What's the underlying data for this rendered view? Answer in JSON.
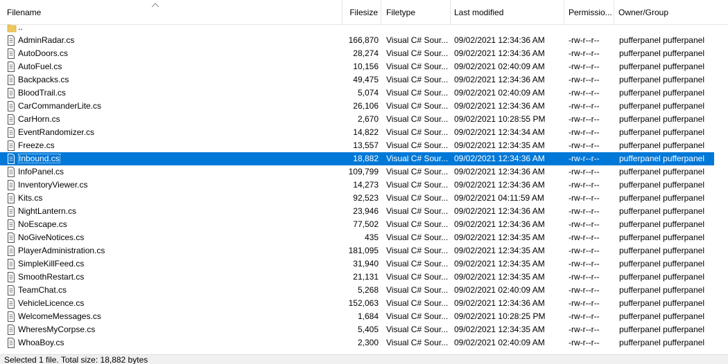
{
  "columns": {
    "filename": "Filename",
    "filesize": "Filesize",
    "filetype": "Filetype",
    "last_modified": "Last modified",
    "permissions": "Permissio...",
    "owner_group": "Owner/Group"
  },
  "parent_dir": "..",
  "files": [
    {
      "name": "AdminRadar.cs",
      "size": "166,870",
      "type": "Visual C# Sour...",
      "modified": "09/02/2021 12:34:36 AM",
      "perm": "-rw-r--r--",
      "owner": "pufferpanel pufferpanel"
    },
    {
      "name": "AutoDoors.cs",
      "size": "28,274",
      "type": "Visual C# Sour...",
      "modified": "09/02/2021 12:34:36 AM",
      "perm": "-rw-r--r--",
      "owner": "pufferpanel pufferpanel"
    },
    {
      "name": "AutoFuel.cs",
      "size": "10,156",
      "type": "Visual C# Sour...",
      "modified": "09/02/2021 02:40:09 AM",
      "perm": "-rw-r--r--",
      "owner": "pufferpanel pufferpanel"
    },
    {
      "name": "Backpacks.cs",
      "size": "49,475",
      "type": "Visual C# Sour...",
      "modified": "09/02/2021 12:34:36 AM",
      "perm": "-rw-r--r--",
      "owner": "pufferpanel pufferpanel"
    },
    {
      "name": "BloodTrail.cs",
      "size": "5,074",
      "type": "Visual C# Sour...",
      "modified": "09/02/2021 02:40:09 AM",
      "perm": "-rw-r--r--",
      "owner": "pufferpanel pufferpanel"
    },
    {
      "name": "CarCommanderLite.cs",
      "size": "26,106",
      "type": "Visual C# Sour...",
      "modified": "09/02/2021 12:34:36 AM",
      "perm": "-rw-r--r--",
      "owner": "pufferpanel pufferpanel"
    },
    {
      "name": "CarHorn.cs",
      "size": "2,670",
      "type": "Visual C# Sour...",
      "modified": "09/02/2021 10:28:55 PM",
      "perm": "-rw-r--r--",
      "owner": "pufferpanel pufferpanel"
    },
    {
      "name": "EventRandomizer.cs",
      "size": "14,822",
      "type": "Visual C# Sour...",
      "modified": "09/02/2021 12:34:34 AM",
      "perm": "-rw-r--r--",
      "owner": "pufferpanel pufferpanel"
    },
    {
      "name": "Freeze.cs",
      "size": "13,557",
      "type": "Visual C# Sour...",
      "modified": "09/02/2021 12:34:35 AM",
      "perm": "-rw-r--r--",
      "owner": "pufferpanel pufferpanel"
    },
    {
      "name": "Inbound.cs",
      "size": "18,882",
      "type": "Visual C# Sour...",
      "modified": "09/02/2021 12:34:36 AM",
      "perm": "-rw-r--r--",
      "owner": "pufferpanel pufferpanel",
      "selected": true
    },
    {
      "name": "InfoPanel.cs",
      "size": "109,799",
      "type": "Visual C# Sour...",
      "modified": "09/02/2021 12:34:36 AM",
      "perm": "-rw-r--r--",
      "owner": "pufferpanel pufferpanel"
    },
    {
      "name": "InventoryViewer.cs",
      "size": "14,273",
      "type": "Visual C# Sour...",
      "modified": "09/02/2021 12:34:36 AM",
      "perm": "-rw-r--r--",
      "owner": "pufferpanel pufferpanel"
    },
    {
      "name": "Kits.cs",
      "size": "92,523",
      "type": "Visual C# Sour...",
      "modified": "09/02/2021 04:11:59 AM",
      "perm": "-rw-r--r--",
      "owner": "pufferpanel pufferpanel"
    },
    {
      "name": "NightLantern.cs",
      "size": "23,946",
      "type": "Visual C# Sour...",
      "modified": "09/02/2021 12:34:36 AM",
      "perm": "-rw-r--r--",
      "owner": "pufferpanel pufferpanel"
    },
    {
      "name": "NoEscape.cs",
      "size": "77,502",
      "type": "Visual C# Sour...",
      "modified": "09/02/2021 12:34:36 AM",
      "perm": "-rw-r--r--",
      "owner": "pufferpanel pufferpanel"
    },
    {
      "name": "NoGiveNotices.cs",
      "size": "435",
      "type": "Visual C# Sour...",
      "modified": "09/02/2021 12:34:35 AM",
      "perm": "-rw-r--r--",
      "owner": "pufferpanel pufferpanel"
    },
    {
      "name": "PlayerAdministration.cs",
      "size": "181,095",
      "type": "Visual C# Sour...",
      "modified": "09/02/2021 12:34:35 AM",
      "perm": "-rw-r--r--",
      "owner": "pufferpanel pufferpanel"
    },
    {
      "name": "SimpleKillFeed.cs",
      "size": "31,940",
      "type": "Visual C# Sour...",
      "modified": "09/02/2021 12:34:35 AM",
      "perm": "-rw-r--r--",
      "owner": "pufferpanel pufferpanel"
    },
    {
      "name": "SmoothRestart.cs",
      "size": "21,131",
      "type": "Visual C# Sour...",
      "modified": "09/02/2021 12:34:35 AM",
      "perm": "-rw-r--r--",
      "owner": "pufferpanel pufferpanel"
    },
    {
      "name": "TeamChat.cs",
      "size": "5,268",
      "type": "Visual C# Sour...",
      "modified": "09/02/2021 02:40:09 AM",
      "perm": "-rw-r--r--",
      "owner": "pufferpanel pufferpanel"
    },
    {
      "name": "VehicleLicence.cs",
      "size": "152,063",
      "type": "Visual C# Sour...",
      "modified": "09/02/2021 12:34:36 AM",
      "perm": "-rw-r--r--",
      "owner": "pufferpanel pufferpanel"
    },
    {
      "name": "WelcomeMessages.cs",
      "size": "1,684",
      "type": "Visual C# Sour...",
      "modified": "09/02/2021 10:28:25 PM",
      "perm": "-rw-r--r--",
      "owner": "pufferpanel pufferpanel"
    },
    {
      "name": "WheresMyCorpse.cs",
      "size": "5,405",
      "type": "Visual C# Sour...",
      "modified": "09/02/2021 12:34:35 AM",
      "perm": "-rw-r--r--",
      "owner": "pufferpanel pufferpanel"
    },
    {
      "name": "WhoaBoy.cs",
      "size": "2,300",
      "type": "Visual C# Sour...",
      "modified": "09/02/2021 02:40:09 AM",
      "perm": "-rw-r--r--",
      "owner": "pufferpanel pufferpanel"
    }
  ],
  "status": "Selected 1 file. Total size: 18,882 bytes",
  "colors": {
    "selection": "#0078d7",
    "folder": "#f0c75e"
  },
  "icons": {
    "parent": "folder-icon",
    "file": "file-icon",
    "sort": "sort-ascending-icon"
  }
}
